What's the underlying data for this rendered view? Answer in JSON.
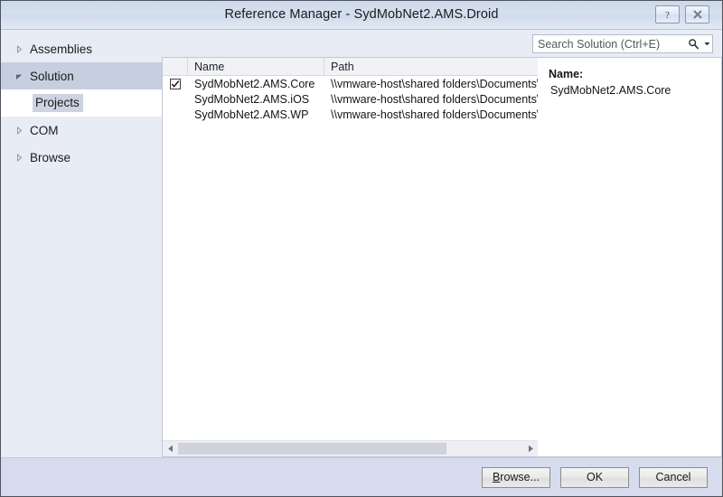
{
  "window": {
    "title": "Reference Manager - SydMobNet2.AMS.Droid",
    "help_button": "?",
    "close_button": "×",
    "help_icon": "question-mark-icon",
    "close_icon": "close-x-icon"
  },
  "sidebar": {
    "items": [
      {
        "label": "Assemblies",
        "expanded": false,
        "selected": false,
        "icon": "chevron-right-icon"
      },
      {
        "label": "Solution",
        "expanded": true,
        "selected": true,
        "icon": "chevron-down-icon"
      },
      {
        "label": "COM",
        "expanded": false,
        "selected": false,
        "icon": "chevron-right-icon"
      },
      {
        "label": "Browse",
        "expanded": false,
        "selected": false,
        "icon": "chevron-right-icon"
      }
    ],
    "children": [
      {
        "label": "Projects",
        "selected": true
      }
    ]
  },
  "search": {
    "placeholder": "Search Solution (Ctrl+E)",
    "value": "",
    "icon": "search-magnifier-icon",
    "dropdown_icon": "chevron-down-icon"
  },
  "list": {
    "columns": [
      {
        "key": "check",
        "label": ""
      },
      {
        "key": "name",
        "label": "Name"
      },
      {
        "key": "path",
        "label": "Path"
      }
    ],
    "rows": [
      {
        "checked": true,
        "name": "SydMobNet2.AMS.Core",
        "path": "\\\\vmware-host\\shared folders\\Documents\\\\"
      },
      {
        "checked": false,
        "name": "SydMobNet2.AMS.iOS",
        "path": "\\\\vmware-host\\shared folders\\Documents\\\\"
      },
      {
        "checked": false,
        "name": "SydMobNet2.AMS.WP",
        "path": "\\\\vmware-host\\shared folders\\Documents\\\\"
      }
    ],
    "scrollbar": {
      "left_icon": "triangle-left-icon",
      "right_icon": "triangle-right-icon",
      "thumb_percent": 78
    }
  },
  "detail": {
    "label": "Name:",
    "value": "SydMobNet2.AMS.Core"
  },
  "footer": {
    "browse_label_prefix": "B",
    "browse_label_rest": "rowse...",
    "ok_label": "OK",
    "cancel_label": "Cancel"
  },
  "colors": {
    "titlebar_top": "#cdd9e8",
    "pane_bg": "#e8ecf5",
    "footer_bg": "#d6dced",
    "selection": "#c6cfdf",
    "child_selection": "#cdd3e1",
    "frame_border": "#4e5360",
    "scroll_thumb": "#d0d3dc"
  }
}
